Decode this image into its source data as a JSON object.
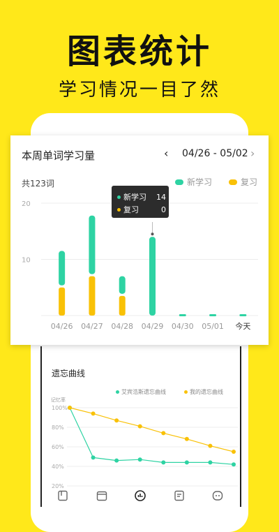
{
  "hero": {
    "title": "图表统计",
    "subtitle": "学习情况一目了然"
  },
  "card": {
    "title": "本周单词学习量",
    "prev_icon": "‹",
    "date_range": "04/26 - 05/02",
    "next_icon": "›",
    "total": "共123词",
    "legend": [
      {
        "label": "新学习",
        "color": "#2ED3A3"
      },
      {
        "label": "复习",
        "color": "#F9C106"
      }
    ]
  },
  "tooltip": {
    "rows": [
      {
        "label": "新学习",
        "value": "14",
        "color": "#2ED3A3"
      },
      {
        "label": "复习",
        "value": "0",
        "color": "#F9C106"
      }
    ]
  },
  "chart_data": [
    {
      "type": "bar",
      "stacked": true,
      "categories": [
        "04/26",
        "04/27",
        "04/28",
        "04/29",
        "04/30",
        "05/01",
        "今天"
      ],
      "series": [
        {
          "name": "复习",
          "values": [
            5,
            7,
            3.5,
            0,
            0,
            0,
            0
          ]
        },
        {
          "name": "新学习",
          "values": [
            6.5,
            10.8,
            3.5,
            14,
            0,
            0,
            0
          ]
        }
      ],
      "yticks": [
        10,
        20
      ],
      "ylim": [
        0,
        20
      ],
      "grid": true,
      "legend_position": "top-right",
      "colors": {
        "复习": "#F9C106",
        "新学习": "#2ED3A3"
      }
    },
    {
      "type": "line",
      "title": "遗忘曲线",
      "ylabel": "记忆率",
      "yticks": [
        "100%",
        "80%",
        "60%",
        "40%",
        "20%"
      ],
      "ylim": [
        20,
        100
      ],
      "series": [
        {
          "name": "艾宾浩斯遗忘曲线",
          "values": [
            100,
            49,
            46,
            47,
            44,
            44,
            44,
            42
          ],
          "color": "#2ED3A3"
        },
        {
          "name": "我的遗忘曲线",
          "values": [
            100,
            94,
            87,
            81,
            74,
            68,
            61,
            55
          ],
          "color": "#F9C106"
        }
      ],
      "legend_position": "top"
    }
  ],
  "tabs": [
    {
      "icon": "book-icon"
    },
    {
      "icon": "calendar-icon"
    },
    {
      "icon": "stats-icon"
    },
    {
      "icon": "notes-icon"
    },
    {
      "icon": "profile-icon"
    }
  ]
}
